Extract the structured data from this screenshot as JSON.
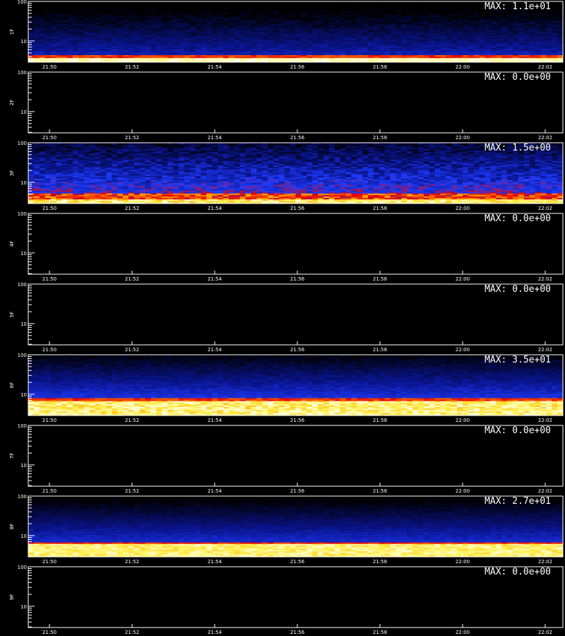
{
  "chart_data": {
    "type": "heatmap",
    "x_ticks": [
      "21:50",
      "21:52",
      "21:54",
      "21:56",
      "21:58",
      "22:00",
      "22:02"
    ],
    "y_ticks": [
      "100",
      "10"
    ],
    "y_scale": "log",
    "panels": [
      {
        "ylabel": "1F",
        "max_text": "MAX: 1.1e+01",
        "max_value": 11,
        "profile": "quiet_low"
      },
      {
        "ylabel": "2F",
        "max_text": "MAX: 0.0e+00",
        "max_value": 0,
        "profile": "empty"
      },
      {
        "ylabel": "3F",
        "max_text": "MAX: 1.5e+00",
        "max_value": 1.5,
        "profile": "noisy"
      },
      {
        "ylabel": "4F",
        "max_text": "MAX: 0.0e+00",
        "max_value": 0,
        "profile": "empty"
      },
      {
        "ylabel": "5F",
        "max_text": "MAX: 0.0e+00",
        "max_value": 0,
        "profile": "empty"
      },
      {
        "ylabel": "6F",
        "max_text": "MAX: 3.5e+01",
        "max_value": 35,
        "profile": "strong_band"
      },
      {
        "ylabel": "7F",
        "max_text": "MAX: 0.0e+00",
        "max_value": 0,
        "profile": "empty"
      },
      {
        "ylabel": "8F",
        "max_text": "MAX: 2.7e+01",
        "max_value": 27,
        "profile": "band"
      },
      {
        "ylabel": "9F",
        "max_text": "MAX: 0.0e+00",
        "max_value": 0,
        "profile": "empty"
      }
    ],
    "colors": {
      "background": "#000000",
      "axis": "#ffffff",
      "text": "#ffffff"
    }
  }
}
